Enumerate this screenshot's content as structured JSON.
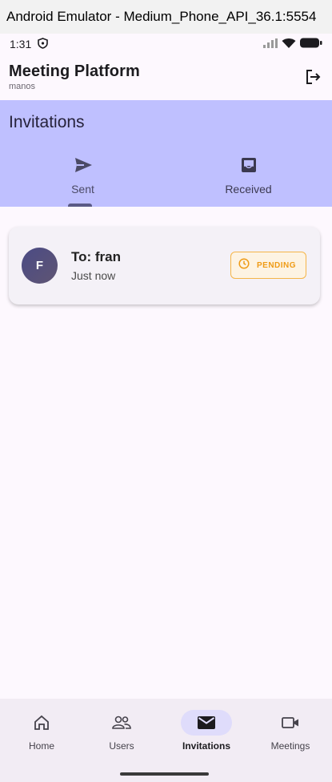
{
  "window": {
    "title": "Android Emulator - Medium_Phone_API_36.1:5554"
  },
  "status_bar": {
    "time": "1:31",
    "icons": [
      "shield-icon",
      "signal-icon",
      "wifi-icon",
      "battery-icon"
    ]
  },
  "app_bar": {
    "title": "Meeting Platform",
    "subtitle": "manos",
    "action_icon": "logout-icon"
  },
  "section": {
    "title": "Invitations",
    "tabs": [
      {
        "label": "Sent",
        "icon": "send-icon",
        "selected": true
      },
      {
        "label": "Received",
        "icon": "inbox-icon",
        "selected": false
      }
    ]
  },
  "invitations": [
    {
      "avatar_letter": "F",
      "title": "To: fran",
      "time": "Just now",
      "status": "PENDING",
      "status_icon": "clock-icon"
    }
  ],
  "bottom_nav": {
    "items": [
      {
        "label": "Home",
        "icon": "home-icon",
        "active": false
      },
      {
        "label": "Users",
        "icon": "users-icon",
        "active": false
      },
      {
        "label": "Invitations",
        "icon": "mail-icon",
        "active": true
      },
      {
        "label": "Meetings",
        "icon": "video-icon",
        "active": false
      }
    ]
  },
  "colors": {
    "header_band": "#bfc0ff",
    "active_nav_pill": "#dfdcfb",
    "pending_accent": "#ef9b16",
    "background": "#fdf8fe"
  }
}
